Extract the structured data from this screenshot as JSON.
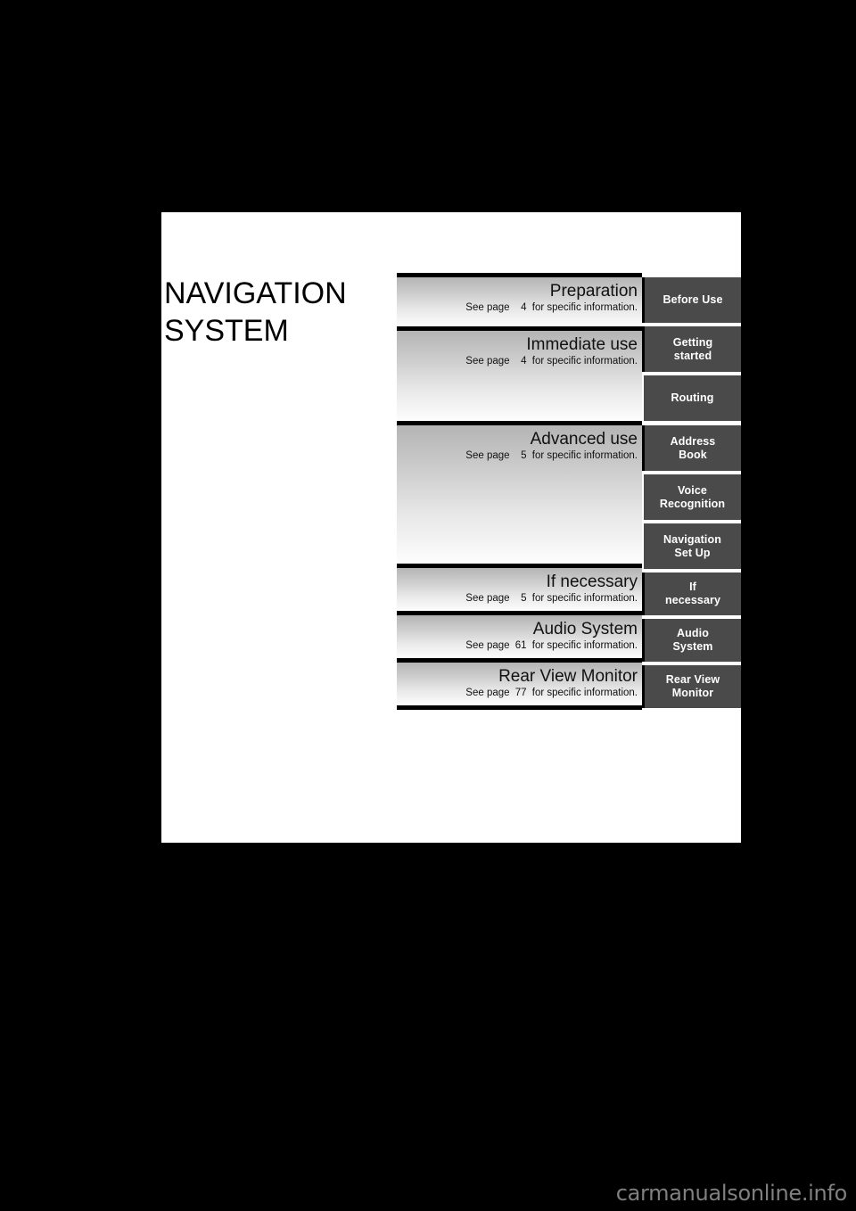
{
  "page": {
    "title_line1": "NAVIGATION",
    "title_line2": "SYSTEM",
    "title": "NAVIGATION\nSYSTEM"
  },
  "watermark": {
    "text": "carmanualsonline.info"
  },
  "table": {
    "see_page_prefix": "See page",
    "see_page_suffix": "for specific information.",
    "sections": [
      {
        "title": "Preparation",
        "page": "4",
        "note_prefix": "See page",
        "note_suffix": "for specific information."
      },
      {
        "title": "Immediate use",
        "page": "4",
        "note_prefix": "See page",
        "note_suffix": "for specific information."
      },
      {
        "title": "Advanced use",
        "page": "5",
        "note_prefix": "See page",
        "note_suffix": "for specific information."
      },
      {
        "title": "If necessary",
        "page": "5",
        "note_prefix": "See page",
        "note_suffix": "for specific information."
      },
      {
        "title": "Audio System",
        "page": "61",
        "note_prefix": "See page",
        "note_suffix": "for specific information."
      },
      {
        "title": "Rear View Monitor",
        "page": "77",
        "note_prefix": "See page",
        "note_suffix": "for specific information."
      }
    ],
    "tabs": [
      {
        "label": "Before Use"
      },
      {
        "label": "Getting\nstarted"
      },
      {
        "label": "Routing"
      },
      {
        "label": "Address\nBook"
      },
      {
        "label": "Voice\nRecognition"
      },
      {
        "label": "Navigation\nSet Up"
      },
      {
        "label": "If\nnecessary"
      },
      {
        "label": "Audio\nSystem"
      },
      {
        "label": "Rear View\nMonitor"
      }
    ]
  },
  "colors": {
    "background": "#000000",
    "sheet": "#ffffff",
    "tab_bg": "#4a4a4a",
    "tab_text": "#ffffff",
    "rule": "#000000",
    "gradient_top": "#b4b4b4",
    "gradient_bottom": "#fdfdfd",
    "watermark": "#808080"
  }
}
